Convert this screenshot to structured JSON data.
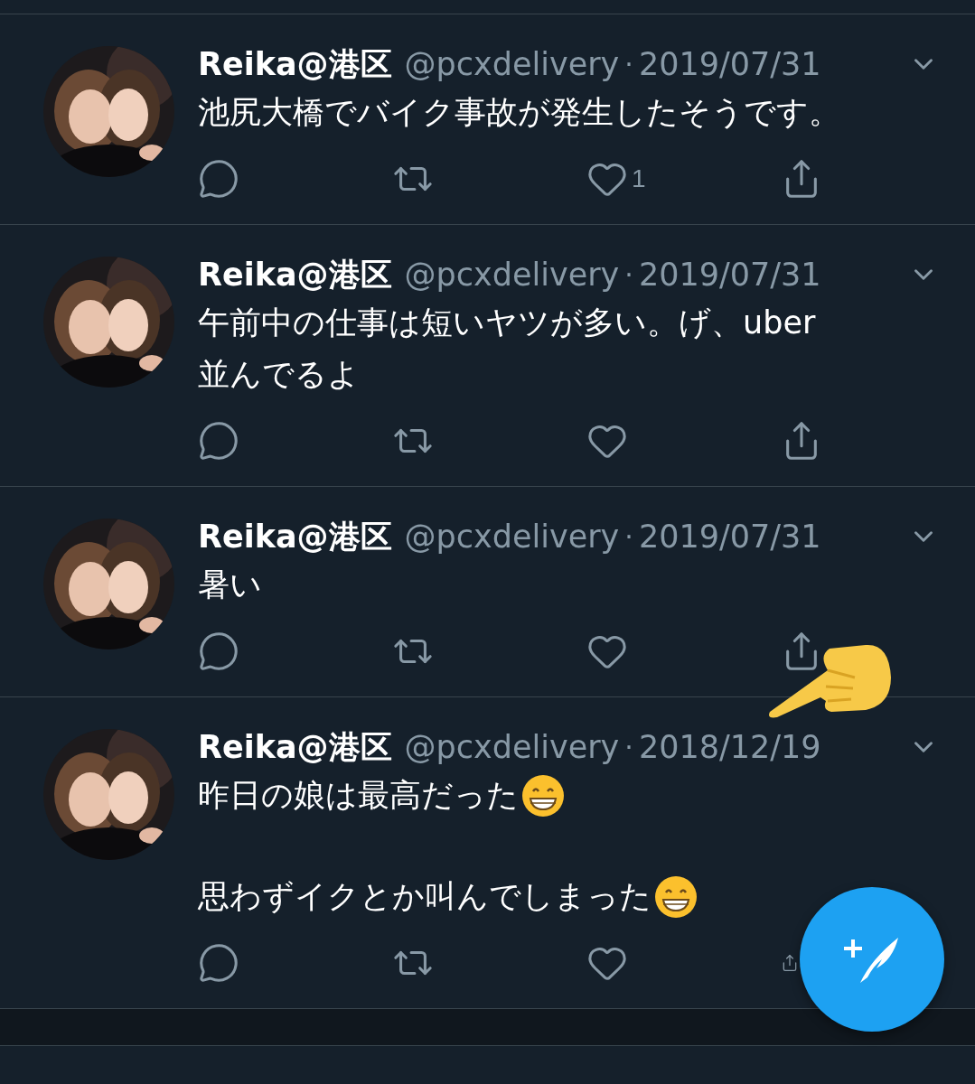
{
  "tweets": [
    {
      "name": "Reika@港区",
      "handle": "@pcxdelivery",
      "separator": "·",
      "date": "2019/07/31",
      "avatar": {
        "kind": "picture"
      },
      "lines": [
        {
          "text": "池尻大橋でバイク事故が発生したそうです。"
        }
      ],
      "actions": [
        {
          "kind": "reply"
        },
        {
          "kind": "retweet"
        },
        {
          "kind": "like",
          "count": "1"
        },
        {
          "kind": "share"
        }
      ]
    },
    {
      "name": "Reika@港区",
      "handle": "@pcxdelivery",
      "separator": "·",
      "date": "2019/07/31",
      "avatar": {
        "kind": "picture"
      },
      "lines": [
        {
          "text": "午前中の仕事は短いヤツが多い。げ、uber"
        },
        {
          "text": "並んでるよ"
        }
      ],
      "actions": [
        {
          "kind": "reply"
        },
        {
          "kind": "retweet"
        },
        {
          "kind": "like"
        },
        {
          "kind": "share"
        }
      ]
    },
    {
      "name": "Reika@港区",
      "handle": "@pcxdelivery",
      "separator": "·",
      "date": "2019/07/31",
      "avatar": {
        "kind": "picture"
      },
      "lines": [
        {
          "text": "暑い"
        }
      ],
      "actions": [
        {
          "kind": "reply"
        },
        {
          "kind": "retweet"
        },
        {
          "kind": "like"
        },
        {
          "kind": "share"
        }
      ]
    },
    {
      "name": "Reika@港区",
      "handle": "@pcxdelivery",
      "separator": "·",
      "date": "2018/12/19",
      "avatar": {
        "kind": "picture"
      },
      "lines": [
        {
          "text": "昨日の娘は最高だった",
          "kind": "grin"
        },
        {
          "text": "思わずイクとか叫んでしまった",
          "kind": "grin",
          "gap_before": true
        }
      ],
      "actions": [
        {
          "kind": "reply"
        },
        {
          "kind": "retweet"
        },
        {
          "kind": "like"
        },
        {
          "kind": "share"
        }
      ]
    }
  ],
  "overlay": {
    "kind": "pointing-hand"
  },
  "compose_button": {
    "kind": "compose"
  }
}
